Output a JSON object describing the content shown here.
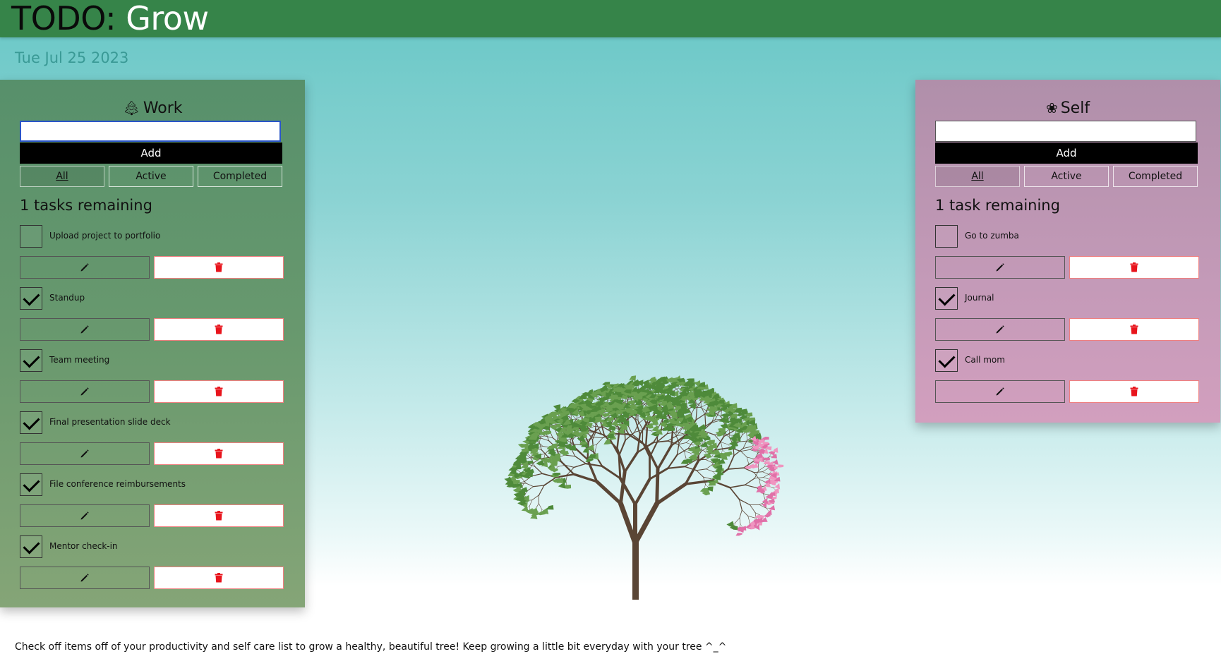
{
  "header": {
    "title_prefix": "TODO: ",
    "title_word": "Grow"
  },
  "date": "Tue Jul 25 2023",
  "colors": {
    "header": "#368449",
    "work_panel": "#57906b",
    "self_panel": "#b08faa",
    "delete_icon": "#e8141c"
  },
  "work": {
    "title": "Work",
    "icon": "tree-icon",
    "input_value": "",
    "add_label": "Add",
    "filters": [
      "All",
      "Active",
      "Completed"
    ],
    "active_filter": "All",
    "remaining": "1 tasks remaining",
    "tasks": [
      {
        "label": "Upload project to portfolio",
        "done": false
      },
      {
        "label": "Standup",
        "done": true
      },
      {
        "label": "Team meeting",
        "done": true
      },
      {
        "label": "Final presentation slide deck",
        "done": true
      },
      {
        "label": "File conference reimbursements",
        "done": true
      },
      {
        "label": "Mentor check-in",
        "done": true
      }
    ]
  },
  "self": {
    "title": "Self",
    "icon": "spa-icon",
    "input_value": "",
    "add_label": "Add",
    "filters": [
      "All",
      "Active",
      "Completed"
    ],
    "active_filter": "All",
    "remaining": "1 task remaining",
    "tasks": [
      {
        "label": "Go to zumba",
        "done": false
      },
      {
        "label": "Journal",
        "done": true
      },
      {
        "label": "Call mom",
        "done": true
      }
    ]
  },
  "footer": "Check off items off of your productivity and self care list to grow a healthy, beautiful tree! Keep growing a little bit everyday with your tree ^_^"
}
